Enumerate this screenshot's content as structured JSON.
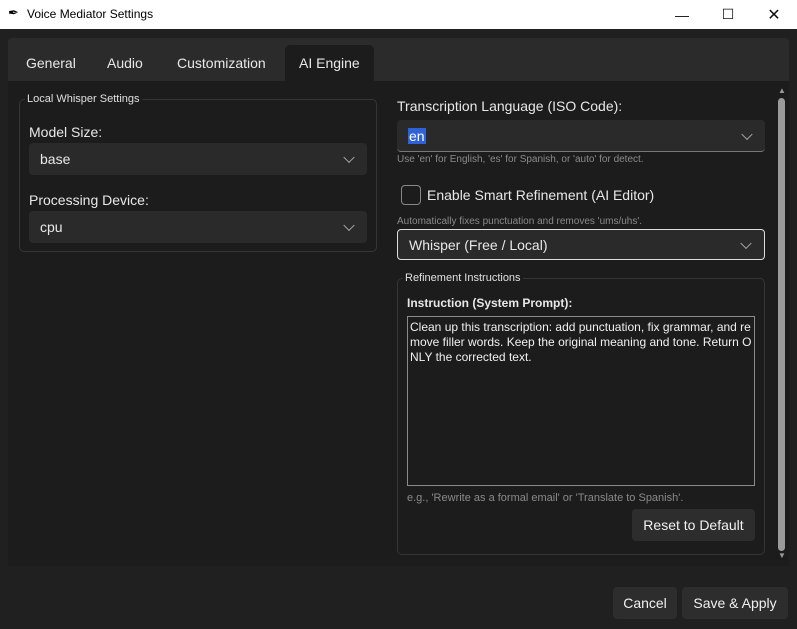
{
  "window": {
    "title": "Voice Mediator Settings",
    "app_icon": "feather-icon"
  },
  "tabs": [
    {
      "label": "General"
    },
    {
      "label": "Audio"
    },
    {
      "label": "Customization"
    },
    {
      "label": "AI Engine",
      "selected": true
    }
  ],
  "local_whisper": {
    "group_label": "Local Whisper Settings",
    "model_size_label": "Model Size:",
    "model_size_value": "base",
    "device_label": "Processing Device:",
    "device_value": "cpu"
  },
  "transcription": {
    "label": "Transcription Language (ISO Code):",
    "value": "en",
    "hint": "Use 'en' for English, 'es' for Spanish, or 'auto' for detect."
  },
  "refinement": {
    "checkbox_label": "Enable Smart Refinement (AI Editor)",
    "checked": false,
    "hint": "Automatically fixes punctuation and removes 'ums/uhs'.",
    "engine_value": "Whisper (Free / Local)"
  },
  "instructions": {
    "group_label": "Refinement Instructions",
    "prompt_label": "Instruction (System Prompt):",
    "prompt_text": "Clean up this transcription: add punctuation, fix grammar, and remove filler words. Keep the original meaning and tone. Return ONLY the corrected text.",
    "hint": "e.g., 'Rewrite as a formal email' or 'Translate to Spanish'.",
    "reset_label": "Reset to Default"
  },
  "footer": {
    "cancel_label": "Cancel",
    "save_label": "Save & Apply"
  },
  "colors": {
    "selection": "#2f62d6",
    "background": "#1c1c1c"
  }
}
